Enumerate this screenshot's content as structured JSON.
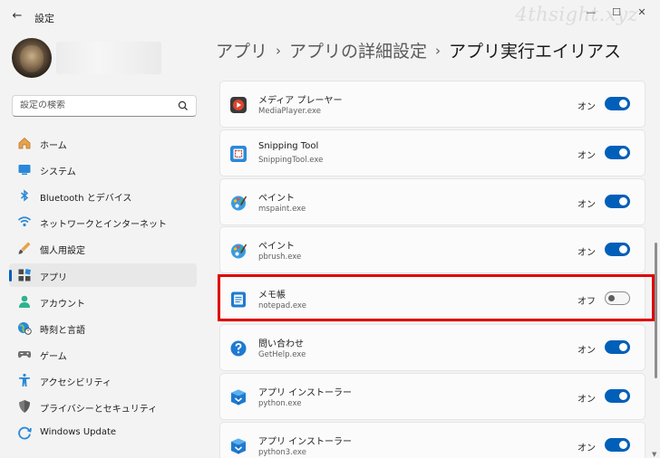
{
  "window": {
    "title": "設定",
    "back_glyph": "←",
    "minimize": "—",
    "maximize": "☐",
    "close": "✕"
  },
  "watermark": "4thsight.xyz",
  "search": {
    "placeholder": "設定の検索"
  },
  "nav": [
    {
      "label": "ホーム",
      "icon": "home-icon"
    },
    {
      "label": "システム",
      "icon": "system-icon"
    },
    {
      "label": "Bluetooth とデバイス",
      "icon": "bluetooth-icon"
    },
    {
      "label": "ネットワークとインターネット",
      "icon": "network-icon"
    },
    {
      "label": "個人用設定",
      "icon": "personalization-icon"
    },
    {
      "label": "アプリ",
      "icon": "apps-icon",
      "active": true
    },
    {
      "label": "アカウント",
      "icon": "account-icon"
    },
    {
      "label": "時刻と言語",
      "icon": "time-language-icon"
    },
    {
      "label": "ゲーム",
      "icon": "gaming-icon"
    },
    {
      "label": "アクセシビリティ",
      "icon": "accessibility-icon"
    },
    {
      "label": "プライバシーとセキュリティ",
      "icon": "privacy-icon"
    },
    {
      "label": "Windows Update",
      "icon": "windows-update-icon"
    }
  ],
  "breadcrumb": {
    "item1": "アプリ",
    "item2": "アプリの詳細設定",
    "current": "アプリ実行エイリアス",
    "separator": "›"
  },
  "aliases": [
    {
      "name": "メディア プレーヤー",
      "exe": "MediaPlayer.exe",
      "state": "オン",
      "on": true,
      "icon": "media-player-icon"
    },
    {
      "name": "Snipping Tool",
      "exe": "SnippingTool.exe",
      "state": "オン",
      "on": true,
      "icon": "snipping-tool-icon"
    },
    {
      "name": "ペイント",
      "exe": "mspaint.exe",
      "state": "オン",
      "on": true,
      "icon": "paint-icon"
    },
    {
      "name": "ペイント",
      "exe": "pbrush.exe",
      "state": "オン",
      "on": true,
      "icon": "paint-icon"
    },
    {
      "name": "メモ帳",
      "exe": "notepad.exe",
      "state": "オフ",
      "on": false,
      "icon": "notepad-icon"
    },
    {
      "name": "問い合わせ",
      "exe": "GetHelp.exe",
      "state": "オン",
      "on": true,
      "icon": "get-help-icon"
    },
    {
      "name": "アプリ インストーラー",
      "exe": "python.exe",
      "state": "オン",
      "on": true,
      "icon": "app-installer-icon"
    },
    {
      "name": "アプリ インストーラー",
      "exe": "python3.exe",
      "state": "オン",
      "on": true,
      "icon": "app-installer-icon"
    }
  ],
  "colors": {
    "accent": "#005fb8",
    "highlight_border": "#e00000"
  }
}
